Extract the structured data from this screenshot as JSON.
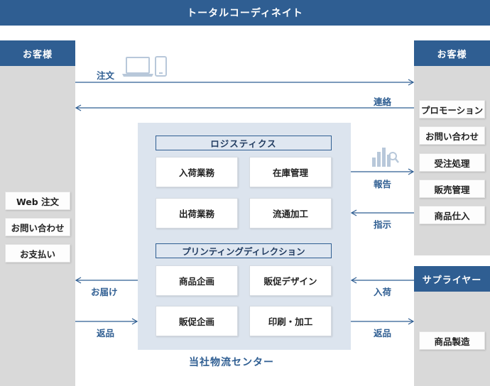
{
  "title": "トータルコーディネイト",
  "left": {
    "header": "お客様",
    "items": [
      "Web 注文",
      "お問い合わせ",
      "お支払い"
    ]
  },
  "right": {
    "customer_header": "お客様",
    "customer_items": [
      "プロモーション",
      "お問い合わせ",
      "受注処理",
      "販売管理",
      "商品仕入"
    ],
    "supplier_header": "サプライヤー",
    "supplier_items": [
      "商品製造"
    ]
  },
  "center": {
    "logistics": {
      "header": "ロジスティクス",
      "cells": [
        "入荷業務",
        "在庫管理",
        "出荷業務",
        "流通加工"
      ]
    },
    "printing": {
      "header": "プリンティングディレクション",
      "cells": [
        "商品企画",
        "販促デザイン",
        "販促企画",
        "印刷・加工"
      ]
    },
    "footer": "当社物流センター"
  },
  "arrows": {
    "order": "注文",
    "contact": "連絡",
    "report": "報告",
    "instruction": "指示",
    "delivery": "お届け",
    "return_left": "返品",
    "arrival": "入荷",
    "return_right": "返品"
  },
  "icons": [
    "laptop-icon",
    "smartphone-icon",
    "bar-chart-magnifier-icon"
  ],
  "colors": {
    "header_blue": "#2f5e92",
    "column_gray": "#d9d9d9",
    "panel_blue": "#dce4ee"
  }
}
